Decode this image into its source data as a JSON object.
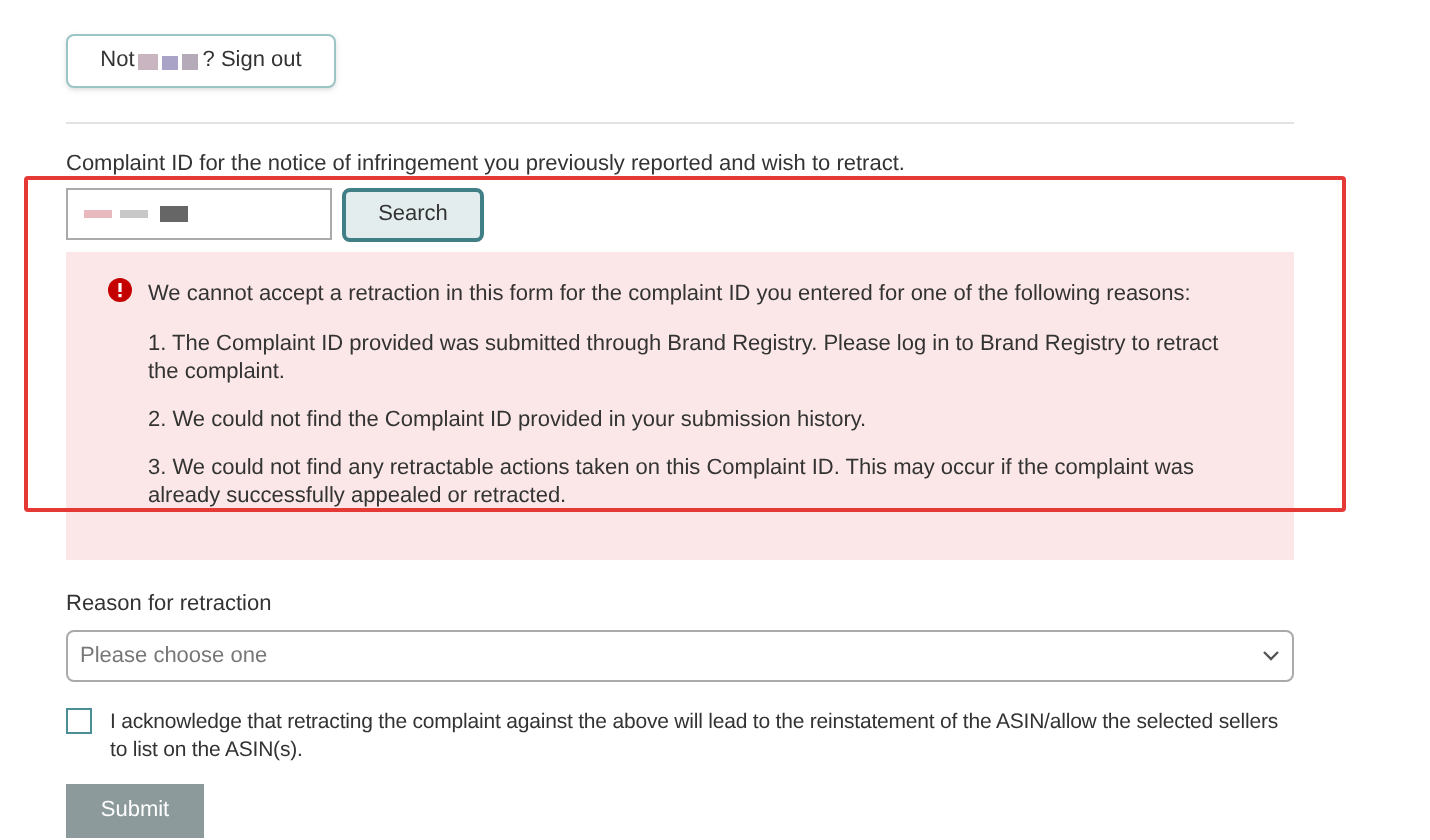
{
  "sign_out_button": {
    "before": "Not",
    "after": "? Sign out"
  },
  "complaint_id": {
    "label": "Complaint ID for the notice of infringement you previously reported and wish to retract.",
    "search_button": "Search"
  },
  "error": {
    "intro": "We cannot accept a retraction in this form for the complaint ID you entered for one of the following reasons:",
    "reasons": [
      "1. The Complaint ID provided was submitted through Brand Registry. Please log in to Brand Registry to retract the complaint.",
      "2. We could not find the Complaint ID provided in your submission history.",
      "3. We could not find any retractable actions taken on this Complaint ID. This may occur if the complaint was already successfully appealed or retracted."
    ]
  },
  "reason": {
    "label": "Reason for retraction",
    "placeholder": "Please choose one"
  },
  "acknowledge": {
    "checked": false,
    "text": "I acknowledge that retracting the complaint against the above will lead to the reinstatement of the ASIN/allow the selected sellers to list on the ASIN(s)."
  },
  "submit_button": {
    "label": "Submit",
    "disabled": true
  }
}
